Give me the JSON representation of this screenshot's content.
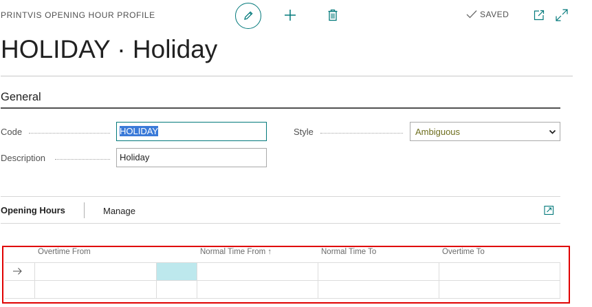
{
  "header": {
    "caption": "PRINTVIS OPENING HOUR PROFILE",
    "status": "SAVED",
    "icons": [
      "edit-icon",
      "plus-icon",
      "trash-icon",
      "check-icon",
      "popout-icon",
      "expand-icon"
    ]
  },
  "page": {
    "title": "HOLIDAY · Holiday"
  },
  "general": {
    "section_title": "General",
    "code_label": "Code",
    "code_value": "HOLIDAY",
    "description_label": "Description",
    "description_value": "Holiday",
    "style_label": "Style",
    "style_value": "Ambiguous"
  },
  "lines": {
    "tab_title": "Opening Hours",
    "manage_label": "Manage",
    "columns": {
      "overtime_from": "Overtime From",
      "normal_time_from": "Normal Time From ↑",
      "normal_time_to": "Normal Time To",
      "overtime_to": "Overtime To"
    },
    "rows": [
      {
        "overtime_from": "",
        "normal_time_from": "",
        "normal_time_to": "",
        "overtime_to": ""
      },
      {
        "overtime_from": "",
        "normal_time_from": "",
        "normal_time_to": "",
        "overtime_to": ""
      }
    ]
  },
  "colors": {
    "accent": "#00787a",
    "highlight_frame": "#e00000",
    "active_cell": "#bde8ed",
    "selection": "#3b7ad8"
  }
}
